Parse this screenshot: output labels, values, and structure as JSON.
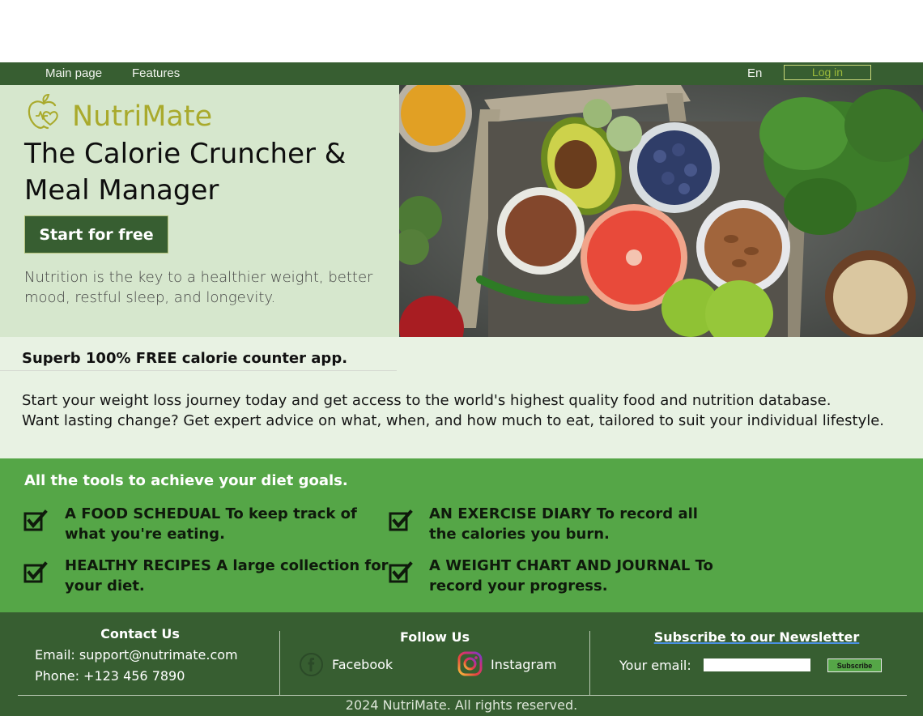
{
  "nav": {
    "main_page": "Main page",
    "features": "Features",
    "language": "En",
    "login": "Log in"
  },
  "hero": {
    "brand": "NutriMate",
    "headline": "The Calorie Cruncher & Meal Manager",
    "cta": "Start for free",
    "description": "Nutrition is the key to a healthier weight, better mood, restful sleep, and longevity."
  },
  "free": {
    "title": "Superb 100% FREE calorie counter app.",
    "line1": "Start your weight loss journey today and get access to the world's highest quality food and nutrition database.",
    "line2": "Want lasting change? Get expert advice on what, when, and how much to eat, tailored to suit your individual lifestyle."
  },
  "tools": {
    "title": "All the tools to achieve your diet goals.",
    "items": [
      "A FOOD SCHEDUAL To keep track of what you're eating.",
      "AN EXERCISE DIARY To record all the calories you burn.",
      "HEALTHY RECIPES A large collection for your diet.",
      "A WEIGHT CHART AND JOURNAL To record your progress."
    ]
  },
  "footer": {
    "contact_title": "Contact Us",
    "email": "Email: support@nutrimate.com",
    "phone": "Phone: +123 456 7890",
    "follow_title": "Follow Us",
    "facebook": "Facebook",
    "instagram": "Instagram",
    "newsletter_title": "Subscribe to our Newsletter",
    "email_label": "Your email:",
    "subscribe": "Subscribe",
    "copyright": "2024 NutriMate. All rights reserved."
  },
  "colors": {
    "nav_green": "#375e31",
    "hero_bg": "#d6e7cd",
    "section_bg": "#e8f2e3",
    "tools_green": "#55a647",
    "brand_olive": "#a9aa2c"
  },
  "icons": [
    "apple-heart-logo-icon",
    "checkbox-checked-icon",
    "facebook-icon",
    "instagram-icon"
  ]
}
